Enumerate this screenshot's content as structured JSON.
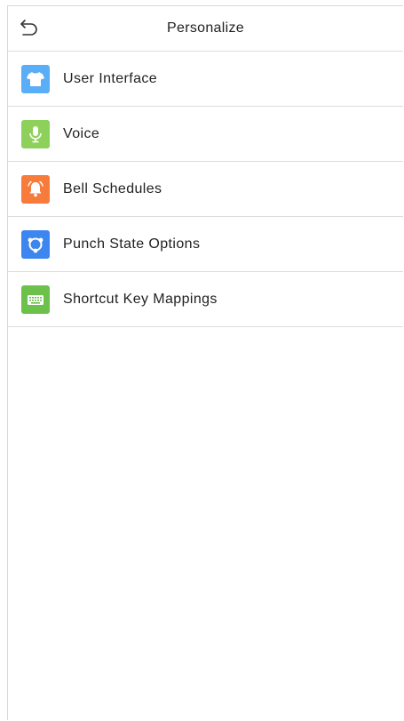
{
  "header": {
    "title": "Personalize",
    "back_icon": "back-arrow-icon"
  },
  "menu": {
    "items": [
      {
        "label": "User Interface",
        "icon": "tshirt-icon",
        "color": "#5aaef7"
      },
      {
        "label": "Voice",
        "icon": "microphone-icon",
        "color": "#8dd05a"
      },
      {
        "label": "Bell Schedules",
        "icon": "bell-icon",
        "color": "#f77b3a"
      },
      {
        "label": "Punch State Options",
        "icon": "punch-state-icon",
        "color": "#3d86f0"
      },
      {
        "label": "Shortcut Key Mappings",
        "icon": "keyboard-icon",
        "color": "#6cc14a"
      }
    ]
  }
}
